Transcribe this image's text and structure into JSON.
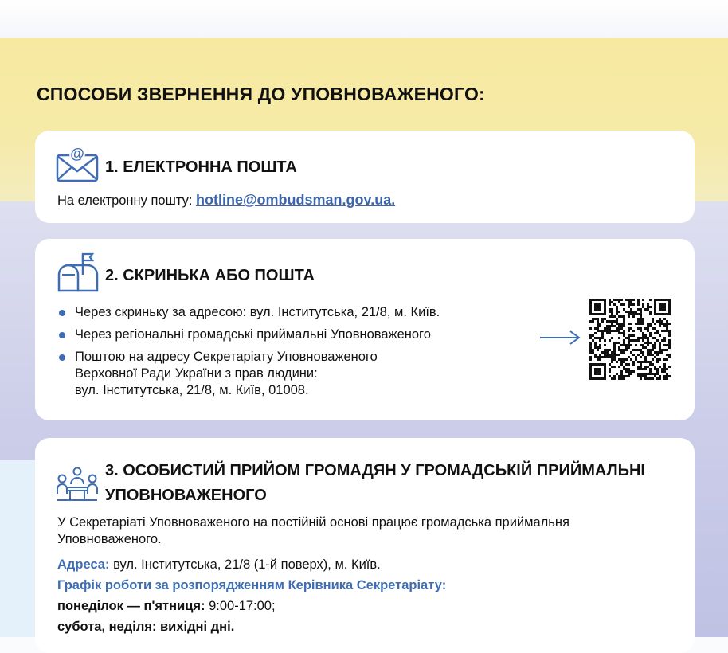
{
  "heading": "СПОСОБИ ЗВЕРНЕННЯ ДО УПОВНОВАЖЕНОГО:",
  "colors": {
    "accent": "#3f6db3",
    "yellow_band": "#f7e9a0",
    "blue_band": "#c9cbe8"
  },
  "email_section": {
    "icon": "envelope-at-icon",
    "title": "1. ЕЛЕКТРОННА ПОШТА",
    "text": "На електронну пошту: ",
    "email": "hotline@ombudsman.gov.ua.",
    "email_href": "mailto:hotline@ombudsman.gov.ua"
  },
  "mailbox_section": {
    "icon": "mailbox-icon",
    "title": "2. СКРИНЬКА АБО ПОШТА",
    "items": [
      "Через скриньку за адресою: вул. Інститутська, 21/8, м. Київ.",
      "Через регіональні громадські приймальні Уповноваженого",
      "Поштою на адресу Секретаріату Уповноваженого\nВерховної Ради України з прав людини:\nвул. Інститутська, 21/8, м. Київ, 01008."
    ],
    "arrow_icon": "arrow-right-icon",
    "qr_icon": "qr-code-icon"
  },
  "reception_section": {
    "icon": "meeting-people-icon",
    "title": "3. ОСОБИСТИЙ ПРИЙОМ ГРОМАДЯН У ГРОМАДСЬКІЙ ПРИЙМАЛЬНІ УПОВНОВАЖЕНОГО",
    "intro": "У Секретаріаті Уповноваженого на постійній основі працює громадська приймальня Уповноваженого.",
    "address_label": "Адреса:",
    "address_value": " вул. Інститутська, 21/8 (1-й поверх), м. Київ.",
    "schedule_label": "Графік роботи за розпорядженням Керівника Секретаріату:",
    "weekday_label": "понеділок — п'ятниця:",
    "weekday_value": " 9:00-17:00;",
    "weekend": "субота, неділя: вихідні дні."
  }
}
